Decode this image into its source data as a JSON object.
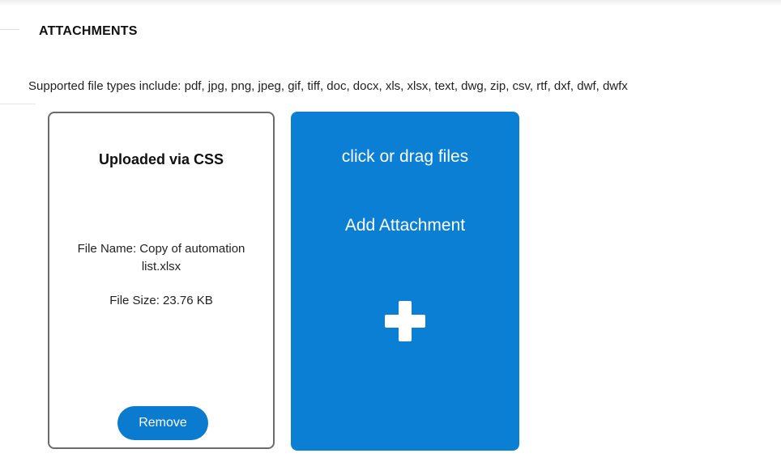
{
  "section": {
    "title": "ATTACHMENTS",
    "supported_types": "Supported file types include: pdf, jpg, png, jpeg, gif, tiff, doc, docx, xls, xlsx, text, dwg, zip, csv, rtf, dxf, dwf, dwfx"
  },
  "attachment": {
    "title": "Uploaded via CSS",
    "file_name": "File Name: Copy of automation list.xlsx",
    "file_size": "File Size: 23.76 KB",
    "remove_label": "Remove"
  },
  "dropzone": {
    "hint": "click or drag files",
    "title": "Add Attachment",
    "icon": "plus-icon"
  },
  "colors": {
    "accent": "#0b7fd4",
    "card_border": "#6b6b6b"
  }
}
